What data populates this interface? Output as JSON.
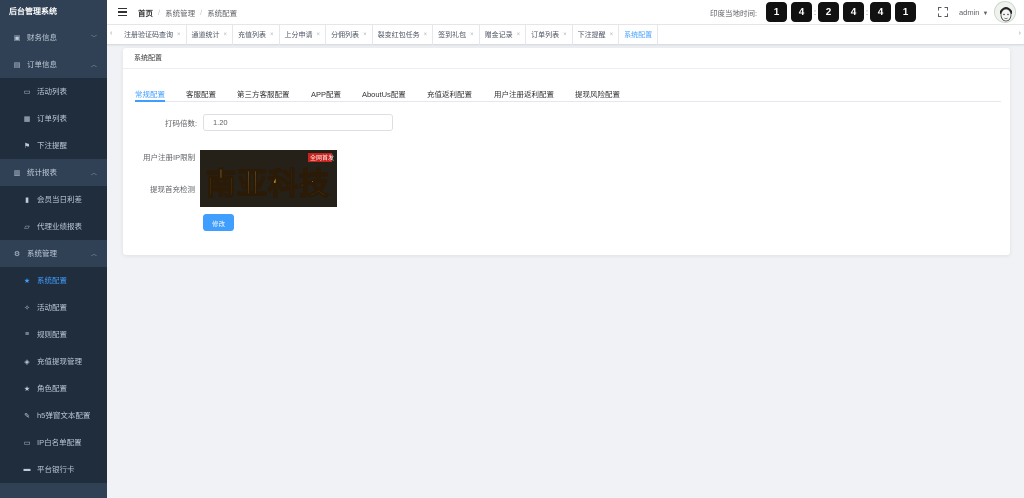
{
  "sidebar": {
    "brand": "后台管理系统",
    "items": [
      {
        "label": "财务信息",
        "icon": "wallet-icon",
        "level": "group",
        "arrow": "﹀"
      },
      {
        "label": "订单信息",
        "icon": "clipboard-icon",
        "level": "group",
        "arrow": "︿"
      },
      {
        "label": "活动列表",
        "icon": "document-icon",
        "level": "sub"
      },
      {
        "label": "订单列表",
        "icon": "list-icon",
        "level": "sub"
      },
      {
        "label": "下注提醒",
        "icon": "flag-icon",
        "level": "sub"
      },
      {
        "label": "统计报表",
        "icon": "chart-icon",
        "level": "group",
        "arrow": "︿"
      },
      {
        "label": "会员当日利差",
        "icon": "bar-chart-icon",
        "level": "sub"
      },
      {
        "label": "代理业绩报表",
        "icon": "report-icon",
        "level": "sub"
      },
      {
        "label": "系统管理",
        "icon": "gear-icon",
        "level": "group",
        "arrow": "︿"
      },
      {
        "label": "系统配置",
        "icon": "star-icon",
        "level": "sub",
        "active": true
      },
      {
        "label": "活动配置",
        "icon": "sparkle-icon",
        "level": "sub"
      },
      {
        "label": "规则配置",
        "icon": "rules-icon",
        "level": "sub"
      },
      {
        "label": "充值提现管理",
        "icon": "layers-icon",
        "level": "sub"
      },
      {
        "label": "角色配置",
        "icon": "star-icon",
        "level": "sub"
      },
      {
        "label": "h5弹窗文本配置",
        "icon": "edit-icon",
        "level": "sub"
      },
      {
        "label": "IP白名单配置",
        "icon": "document-icon",
        "level": "sub"
      },
      {
        "label": "平台银行卡",
        "icon": "card-icon",
        "level": "sub"
      }
    ]
  },
  "navbar": {
    "breadcrumb": [
      "首页",
      "系统管理",
      "系统配置"
    ],
    "clock_label": "印度当地时间:",
    "clock_digits": [
      "1",
      "4",
      "2",
      "4",
      "4",
      "1"
    ],
    "user": "admin"
  },
  "tabs": [
    {
      "label": "注册验证码查询"
    },
    {
      "label": "通道统计"
    },
    {
      "label": "充值列表"
    },
    {
      "label": "上分申请"
    },
    {
      "label": "分佣列表"
    },
    {
      "label": "裂变红包任务"
    },
    {
      "label": "签到礼包"
    },
    {
      "label": "赠金记录"
    },
    {
      "label": "订单列表"
    },
    {
      "label": "下注提醒"
    },
    {
      "label": "系统配置",
      "active": true
    }
  ],
  "main": {
    "card_title": "系统配置",
    "inner_tabs": [
      "常规配置",
      "客服配置",
      "第三方客服配置",
      "APP配置",
      "AboutUs配置",
      "充值返利配置",
      "用户注册返利配置",
      "提现风险配置"
    ],
    "form": {
      "multiplier_label": "打码倍数:",
      "multiplier_value": "1.20",
      "ip_limit_label": "用户注册IP限制",
      "withdraw_label": "提现首充检测",
      "submit_label": "修改"
    },
    "logo_text": "南亚科技",
    "logo_seal": "全网首发"
  },
  "colors": {
    "sidebar_bg": "#304156",
    "accent": "#409eff",
    "text": "#303133"
  }
}
